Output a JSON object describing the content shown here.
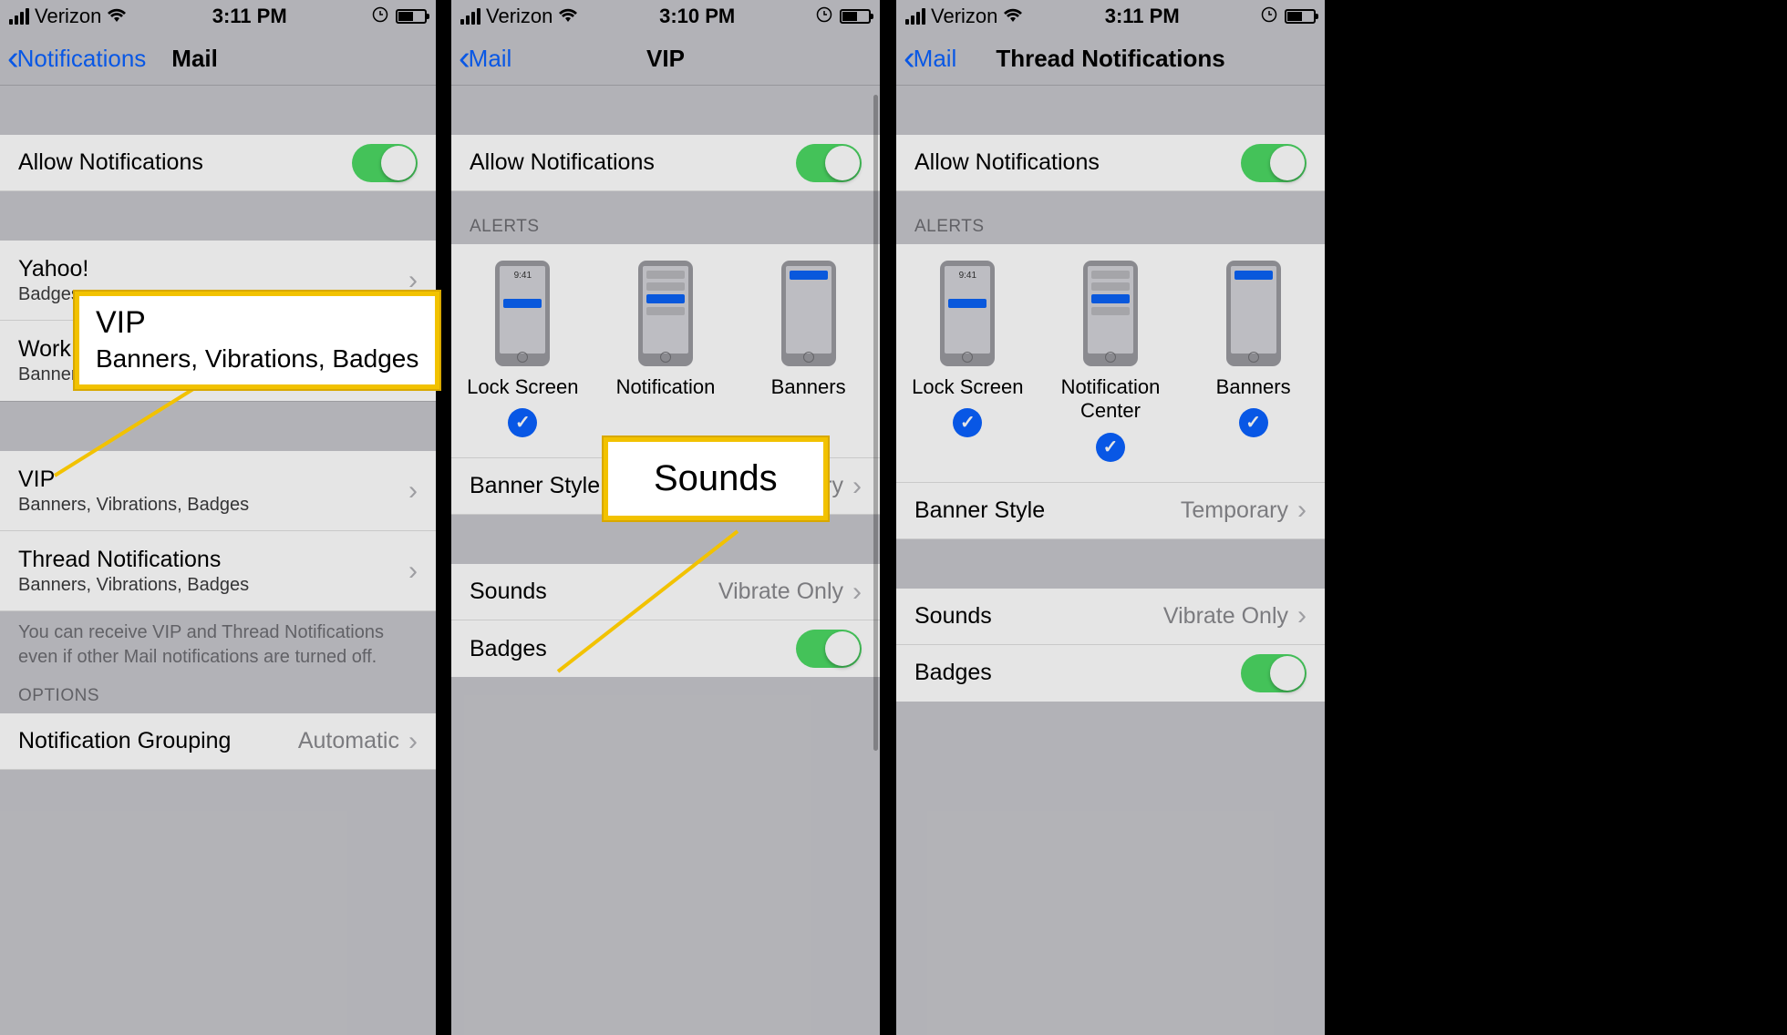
{
  "status": {
    "carrier": "Verizon",
    "time1": "3:11 PM",
    "time2": "3:10 PM",
    "time3": "3:11 PM"
  },
  "p1": {
    "back": "Notifications",
    "title": "Mail",
    "allow": "Allow Notifications",
    "accounts": [
      {
        "name": "Yahoo!",
        "detail": "Badges"
      },
      {
        "name": "Work",
        "detail": "Banner"
      }
    ],
    "vip_name": "VIP",
    "vip_detail": "Banners, Vibrations, Badges",
    "thread_name": "Thread Notifications",
    "thread_detail": "Banners, Vibrations, Badges",
    "explain": "You can receive VIP and Thread Notifications even if other Mail notifications are turned off.",
    "opts_header": "OPTIONS",
    "grouping_label": "Notification Grouping",
    "grouping_value": "Automatic"
  },
  "p2": {
    "back": "Mail",
    "title": "VIP",
    "allow": "Allow Notifications",
    "alerts_header": "ALERTS",
    "alert_labels": [
      "Lock Screen",
      "Notification",
      "Banners"
    ],
    "preview_time": "9:41",
    "banner_style_label": "Banner Style",
    "banner_style_value": "Temporary",
    "sounds_label": "Sounds",
    "sounds_value": "Vibrate Only",
    "badges_label": "Badges"
  },
  "p3": {
    "back": "Mail",
    "title": "Thread Notifications",
    "allow": "Allow Notifications",
    "alerts_header": "ALERTS",
    "alert_labels": [
      "Lock Screen",
      "Notification Center",
      "Banners"
    ],
    "preview_time": "9:41",
    "banner_style_label": "Banner Style",
    "banner_style_value": "Temporary",
    "sounds_label": "Sounds",
    "sounds_value": "Vibrate Only",
    "badges_label": "Badges"
  },
  "callouts": {
    "c1_title": "VIP",
    "c1_sub": "Banners, Vibrations, Badges",
    "c2_title": "Sounds"
  }
}
